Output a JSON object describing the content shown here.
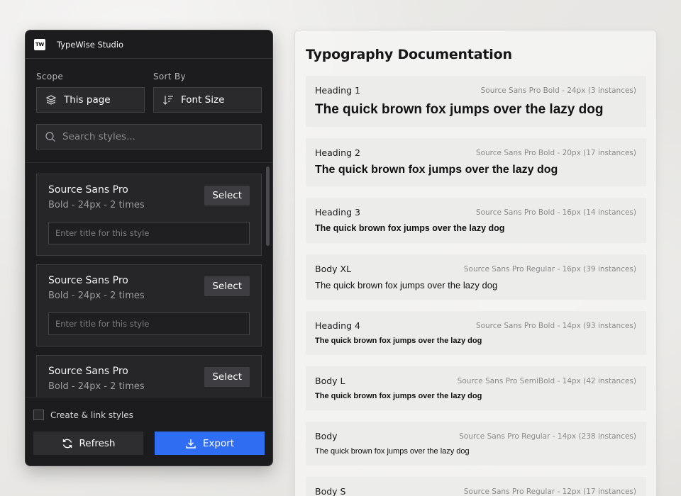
{
  "app": {
    "logo_text": "TW",
    "title": "TypeWise Studio"
  },
  "controls": {
    "scope_label": "Scope",
    "sort_label": "Sort By",
    "scope_value": "This page",
    "sort_value": "Font Size",
    "search_placeholder": "Search styles..."
  },
  "styles_list": [
    {
      "name": "Source Sans Pro",
      "meta": "Bold - 24px - 2 times",
      "select_label": "Select",
      "title_placeholder": "Enter title for this style"
    },
    {
      "name": "Source Sans Pro",
      "meta": "Bold - 24px - 2 times",
      "select_label": "Select",
      "title_placeholder": "Enter title for this style"
    },
    {
      "name": "Source Sans Pro",
      "meta": "Bold - 24px - 2 times",
      "select_label": "Select",
      "title_placeholder": "Enter title for this style"
    }
  ],
  "footer": {
    "checkbox_label": "Create & link styles",
    "refresh_label": "Refresh",
    "export_label": "Export"
  },
  "doc": {
    "title": "Typography Documentation",
    "sample_text": "The quick brown fox jumps over the lazy dog",
    "entries": [
      {
        "name": "Heading 1",
        "spec": "Source Sans Pro Bold - 24px (3 instances)"
      },
      {
        "name": "Heading 2",
        "spec": "Source Sans Pro Bold - 20px (17 instances)"
      },
      {
        "name": "Heading 3",
        "spec": "Source Sans Pro Bold - 16px (14 instances)"
      },
      {
        "name": "Body XL",
        "spec": "Source Sans Pro Regular - 16px (39 instances)"
      },
      {
        "name": "Heading 4",
        "spec": "Source Sans Pro Bold - 14px (93 instances)"
      },
      {
        "name": "Body L",
        "spec": "Source Sans Pro SemiBold - 14px (42 instances)"
      },
      {
        "name": "Body",
        "spec": "Source Sans Pro Regular - 14px (238 instances)"
      },
      {
        "name": "Body S",
        "spec": "Source Sans Pro Regular - 12px (17 instances)"
      }
    ]
  },
  "colors": {
    "accent": "#2f6df2",
    "panel_bg": "#1c1c1e"
  }
}
